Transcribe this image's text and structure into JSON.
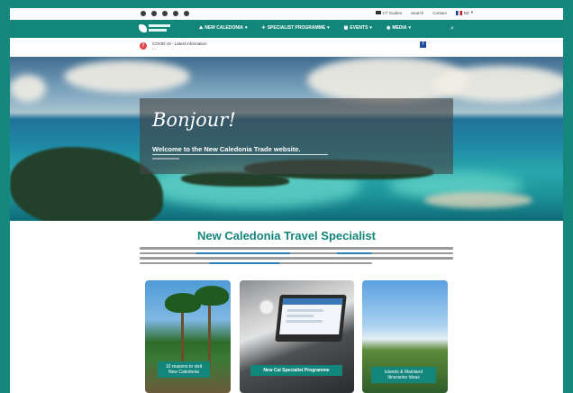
{
  "utility_bar": {
    "social_icons": [
      "twitter-icon",
      "instagram-icon",
      "vimeo-icon",
      "facebook-icon",
      "youtube-icon"
    ],
    "items": [
      "CT Guides",
      "Search",
      "Contact"
    ],
    "language": "NZ"
  },
  "nav": {
    "items": [
      {
        "label": "NEW CALEDONIA",
        "icon": "island-icon"
      },
      {
        "label": "SPECIALIST PROGRAMME",
        "icon": "plane-icon"
      },
      {
        "label": "EVENTS",
        "icon": "calendar-icon"
      },
      {
        "label": "MEDIA",
        "icon": "camera-icon"
      }
    ]
  },
  "notice": {
    "icon": "alert-icon",
    "title": "COVID-19 - Latest information"
  },
  "hero": {
    "title": "Bonjour!",
    "subtitle": "Welcome to the New Caledonia Trade website."
  },
  "main": {
    "heading": "New Caledonia Travel Specialist"
  },
  "cards": [
    {
      "caption": "10 reasons to visit New Caledonia"
    },
    {
      "caption": "New Cal Specialist Programme"
    },
    {
      "caption": "Islands & Mainland Itineraries Ideas"
    }
  ],
  "colors": {
    "brand_teal": "#13867b",
    "page_border": "#16877d",
    "notice_red": "#e0474c",
    "link_blue": "#2a7fb8"
  }
}
